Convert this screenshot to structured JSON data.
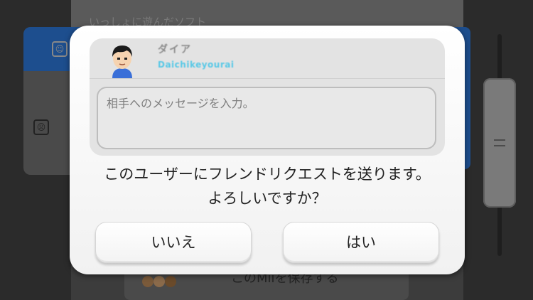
{
  "background": {
    "heading": "いっしょに遊んだソフト",
    "save_mii_label": "このMiiを保存する"
  },
  "dialog": {
    "user": {
      "name": "ダイア",
      "id": "Daichikeyourai"
    },
    "message_placeholder": "相手へのメッセージを入力。",
    "confirm_line1": "このユーザーにフレンドリクエストを送ります。",
    "confirm_line2": "よろしいですか？",
    "no_label": "いいえ",
    "yes_label": "はい"
  },
  "colors": {
    "user_id": "#58c8e6",
    "background_accent": "#1d4e8e"
  }
}
